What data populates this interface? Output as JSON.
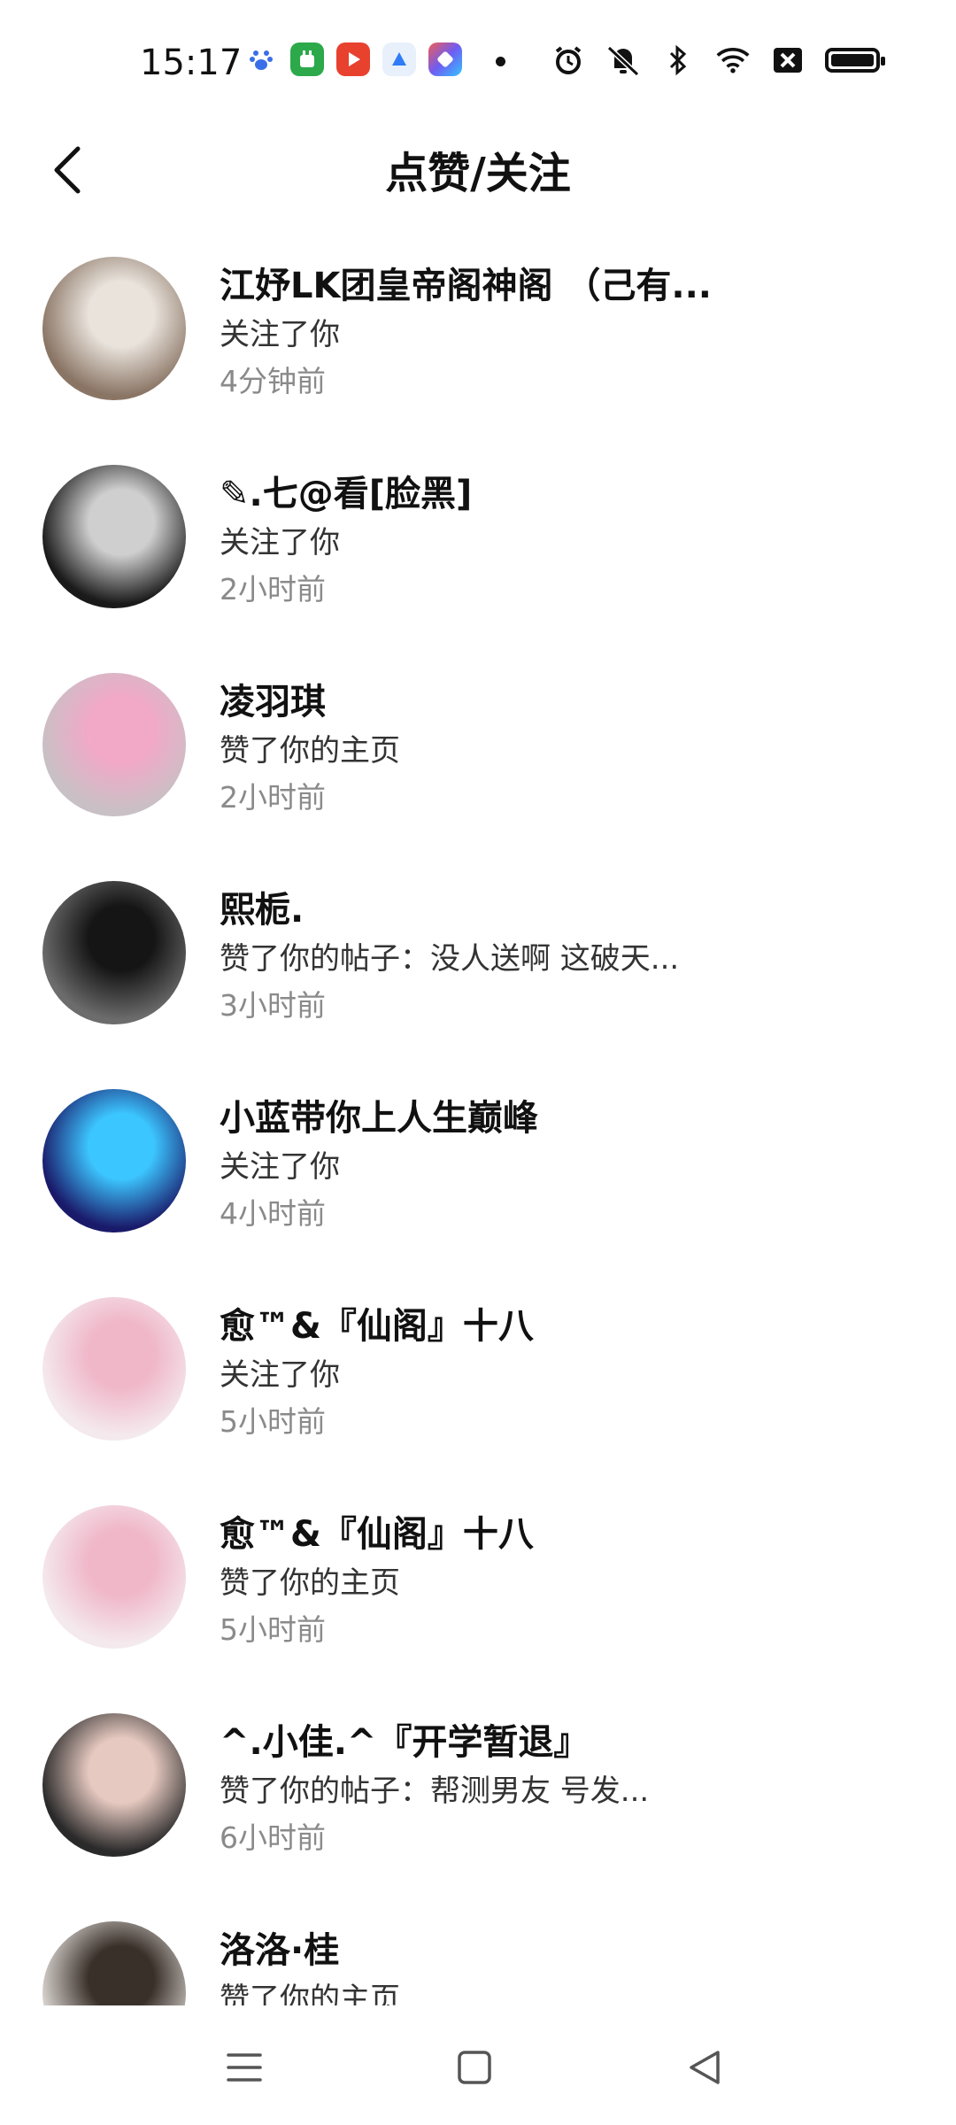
{
  "status_bar": {
    "time": "15:17",
    "app_icons": [
      "baidu-icon",
      "app-green-icon",
      "video-red-icon",
      "blue-app-icon",
      "photo-app-icon"
    ],
    "right_icons": [
      "alarm-icon",
      "mute-icon",
      "bluetooth-icon",
      "wifi-icon",
      "no-sim-icon",
      "battery-icon"
    ]
  },
  "header": {
    "title": "点赞/关注"
  },
  "items": [
    {
      "name": "江妤LK团皇帝阁神阁 （己有...",
      "action": "关注了你",
      "time": "4分钟前",
      "avatar_colors": [
        "#8a7565",
        "#e9e3dc"
      ]
    },
    {
      "name": "✎.七@看[脸黑]",
      "action": "关注了你",
      "time": "2小时前",
      "avatar_colors": [
        "#1a1a1a",
        "#cfcfcf"
      ]
    },
    {
      "name": "凌羽琪",
      "action": "赞了你的主页",
      "time": "2小时前",
      "avatar_colors": [
        "#c8c0c4",
        "#f2a9c8"
      ]
    },
    {
      "name": "熙栀.",
      "action": "赞了你的帖子：没人送啊   这破天...",
      "time": "3小时前",
      "avatar_colors": [
        "#6c6c6c",
        "#151515"
      ]
    },
    {
      "name": "小蓝带你上人生巅峰",
      "action": "关注了你",
      "time": "4小时前",
      "avatar_colors": [
        "#1a1a6a",
        "#3cc6ff"
      ]
    },
    {
      "name": "愈™&『仙阁』十八",
      "action": "关注了你",
      "time": "5小时前",
      "avatar_colors": [
        "#f4eaee",
        "#f0b7c9"
      ]
    },
    {
      "name": "愈™&『仙阁』十八",
      "action": "赞了你的主页",
      "time": "5小时前",
      "avatar_colors": [
        "#f4eaee",
        "#f0b7c9"
      ]
    },
    {
      "name": "^.小佳.^『开学暂退』",
      "action": "赞了你的帖子：帮测男友   号发...",
      "time": "6小时前",
      "avatar_colors": [
        "#2a2a2a",
        "#e6c9c0"
      ]
    },
    {
      "name": "洛洛·桂",
      "action": "赞了你的主页",
      "time": "",
      "avatar_colors": [
        "#d9d4d0",
        "#3a302a"
      ]
    }
  ],
  "nav": {
    "icons": [
      "menu-icon",
      "home-square-icon",
      "back-triangle-icon"
    ]
  }
}
